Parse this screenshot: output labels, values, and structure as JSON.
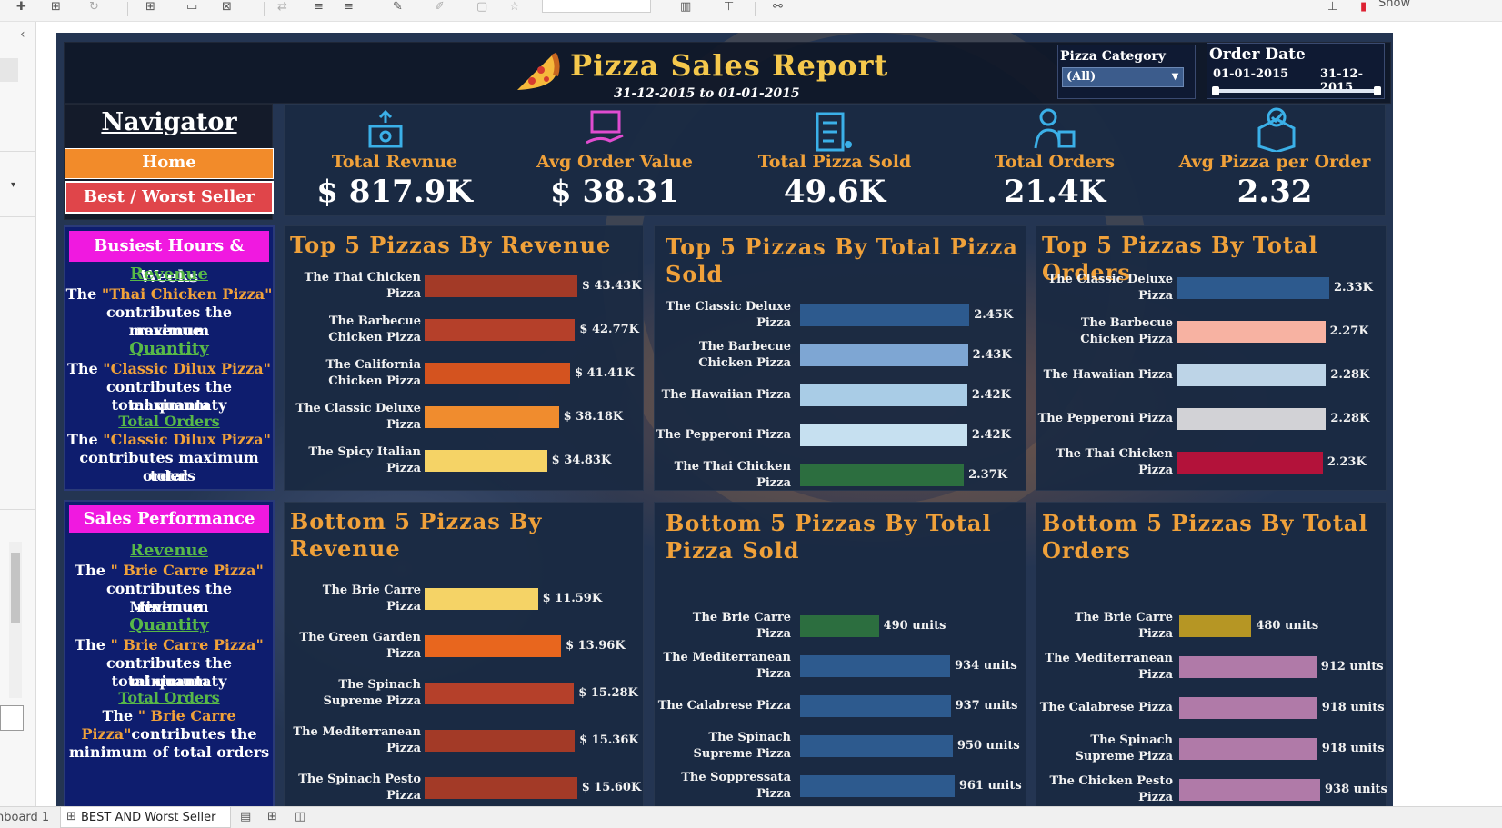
{
  "tabs": {
    "sheet1": "hboard 1",
    "active": "BEST AND Worst Seller"
  },
  "toolbar": {
    "show_label": "Show"
  },
  "header": {
    "title": "Pizza Sales Report",
    "subtitle": "31-12-2015 to 01-01-2015",
    "category_label": "Pizza Category",
    "category_value": "(All)",
    "date_label": "Order Date",
    "date_start": "01-01-2015",
    "date_end": "31-12-2015",
    "date_slider_fraction": 1.0
  },
  "navigator": {
    "title": "Navigator",
    "home": "Home",
    "best_worst": "Best / Worst Seller"
  },
  "kpis": [
    {
      "label": "Total Revnue",
      "value": "$ 817.9K",
      "icon": "money-hand-icon"
    },
    {
      "label": "Avg Order Value",
      "value": "$ 38.31",
      "icon": "box-hand-icon"
    },
    {
      "label": "Total Pizza Sold",
      "value": "49.6K",
      "icon": "clipboard-cart-icon"
    },
    {
      "label": "Total Orders",
      "value": "21.4K",
      "icon": "delivery-person-icon"
    },
    {
      "label": "Avg Pizza per Order",
      "value": "2.32",
      "icon": "box-check-icon"
    }
  ],
  "busiest": {
    "title": "Busiest Hours & Weeks",
    "h1": "Revenue",
    "t1a": "The ",
    "t1b": "\"Thai Chicken Pizza\"",
    "t1c": "contributes the maximum",
    "t1d": "revenue",
    "h2": "Quantity",
    "t2a": "The ",
    "t2b": "\"Classic Dilux Pizza\"",
    "t2c": "contributes the maximum",
    "t2d": "total quantaty",
    "h3": "Total Orders",
    "t3a": "The ",
    "t3b": "\"Classic Dilux Pizza\"",
    "t3c": "contributes maximum total",
    "t3d": "orders"
  },
  "sales_perf": {
    "title": "Sales Performance",
    "h1": "Revenue",
    "t1a": "The ",
    "t1b": "\" Brie Carre Pizza\"",
    "t1c": "contributes the Minimum",
    "t1d": "revenue",
    "h2": "Quantity",
    "t2a": "The ",
    "t2b": "\" Brie Carre Pizza\"",
    "t2c": "contributes the minimum",
    "t2d": "total quantaty",
    "h3": "Total Orders",
    "t3a": "The ",
    "t3b": "\" Brie Carre",
    "t3c": "Pizza\"",
    "t3d": "contributes the",
    "t3e": "minimum of total orders"
  },
  "chart_data": [
    {
      "type": "bar",
      "title": "Top 5 Pizzas By Revenue",
      "categories": [
        "The Thai Chicken Pizza",
        "The Barbecue Chicken Pizza",
        "The California Chicken Pizza",
        "The Classic Deluxe Pizza",
        "The Spicy Italian Pizza"
      ],
      "values": [
        43.43,
        42.77,
        41.41,
        38.18,
        34.83
      ],
      "labels": [
        "$ 43.43K",
        "$ 42.77K",
        "$ 41.41K",
        "$ 38.18K",
        "$ 34.83K"
      ],
      "colors": [
        "#a33a27",
        "#b5402a",
        "#d4531f",
        "#f08c2e",
        "#f5d366"
      ]
    },
    {
      "type": "bar",
      "title": "Top 5 Pizzas By Total Pizza Sold",
      "categories": [
        "The Classic Deluxe Pizza",
        "The Barbecue Chicken Pizza",
        "The Hawaiian Pizza",
        "The Pepperoni Pizza",
        "The Thai Chicken Pizza"
      ],
      "values": [
        2.45,
        2.43,
        2.42,
        2.42,
        2.37
      ],
      "labels": [
        "2.45K",
        "2.43K",
        "2.42K",
        "2.42K",
        "2.37K"
      ],
      "colors": [
        "#2d5a8e",
        "#7ea6d3",
        "#a9cce6",
        "#c6e0f0",
        "#2c6e3f"
      ]
    },
    {
      "type": "bar",
      "title": "Top 5 Pizzas By Total Orders",
      "categories": [
        "The Classic Deluxe Pizza",
        "The Barbecue Chicken Pizza",
        "The Hawaiian Pizza",
        "The Pepperoni Pizza",
        "The Thai Chicken Pizza"
      ],
      "values": [
        2.33,
        2.27,
        2.28,
        2.28,
        2.23
      ],
      "labels": [
        "2.33K",
        "2.27K",
        "2.28K",
        "2.28K",
        "2.23K"
      ],
      "colors": [
        "#2d5a8e",
        "#f7b2a2",
        "#bdd4e7",
        "#d2d2d6",
        "#b3123a"
      ]
    },
    {
      "type": "bar",
      "title": "Bottom 5 Pizzas By Revenue",
      "categories": [
        "The Brie Carre Pizza",
        "The Green Garden Pizza",
        "The Spinach Supreme Pizza",
        "The Mediterranean Pizza",
        "The Spinach Pesto Pizza"
      ],
      "values": [
        11.59,
        13.96,
        15.28,
        15.36,
        15.6
      ],
      "labels": [
        "$ 11.59K",
        "$ 13.96K",
        "$ 15.28K",
        "$ 15.36K",
        "$ 15.60K"
      ],
      "colors": [
        "#f5d366",
        "#e8661e",
        "#b5402a",
        "#a33a27",
        "#a33a27"
      ]
    },
    {
      "type": "bar",
      "title": "Bottom 5 Pizzas By Total Pizza Sold",
      "categories": [
        "The Brie Carre Pizza",
        "The Mediterranean Pizza",
        "The Calabrese Pizza",
        "The Spinach Supreme Pizza",
        "The Soppressata Pizza"
      ],
      "values": [
        490,
        934,
        937,
        950,
        961
      ],
      "labels": [
        "490 units",
        "934 units",
        "937 units",
        "950 units",
        "961 units"
      ],
      "colors": [
        "#2c6e3f",
        "#2d5a8e",
        "#2d5a8e",
        "#2d5a8e",
        "#2d5a8e"
      ]
    },
    {
      "type": "bar",
      "title": "Bottom 5 Pizzas By Total Orders",
      "categories": [
        "The Brie Carre Pizza",
        "The Mediterranean Pizza",
        "The Calabrese Pizza",
        "The Spinach Supreme Pizza",
        "The Chicken Pesto Pizza"
      ],
      "values": [
        480,
        912,
        918,
        918,
        938
      ],
      "labels": [
        "480 units",
        "912 units",
        "918 units",
        "918 units",
        "938 units"
      ],
      "colors": [
        "#b69624",
        "#b07aa8",
        "#b07aa8",
        "#b07aa8",
        "#b07aa8"
      ]
    }
  ]
}
